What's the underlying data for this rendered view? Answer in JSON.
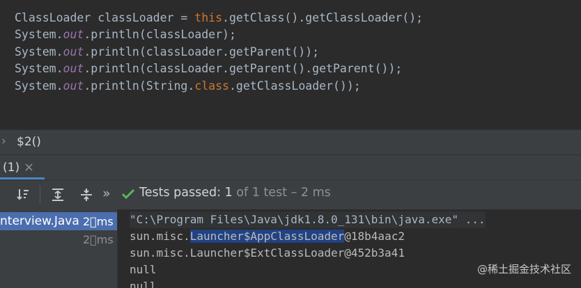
{
  "editor": {
    "line1": {
      "a": "ClassLoader classLoader = ",
      "kw": "this",
      "b": ".getClass().getClassLoader();"
    },
    "line2": {
      "a": "System.",
      "it": "out",
      "b": ".println(classLoader);"
    },
    "line3": {
      "a": "System.",
      "it": "out",
      "b": ".println(classLoader.getParent());"
    },
    "line4": {
      "a": "System.",
      "it": "out",
      "b": ".println(classLoader.getParent().getParent());"
    },
    "line5": {
      "a": "System.",
      "it": "out",
      "b": ".println(String.",
      "kw": "class",
      "c": ".getClassLoader());"
    }
  },
  "run_header": {
    "chevron": "›",
    "title": "$2()"
  },
  "tab": {
    "label": "(1)",
    "close": "×"
  },
  "toolbar": {
    "status_text": "Tests passed:",
    "count": "1",
    "count_of": "of 1 test",
    "duration": "– 2  ms",
    "more": "»"
  },
  "tree": {
    "items": [
      {
        "label": "nterview.Java",
        "time": "2\u0000ms"
      },
      {
        "label": "",
        "time": "2\u0000ms"
      }
    ]
  },
  "console": {
    "lines": [
      "\"C:\\Program Files\\Java\\jdk1.8.0_131\\bin\\java.exe\" ...",
      "sun.misc.",
      "sun.misc.Launcher$ExtClassLoader@452b3a41",
      "null",
      "null"
    ],
    "line2_highlight": "Launcher$AppClassLoader",
    "line2_rest": "@18b4aac2"
  },
  "watermark": "@稀土掘金技术社区",
  "colors": {
    "keyword": "#cc7832",
    "field": "#9876aa",
    "selection": "#4b6eaf",
    "pass": "#5fb35f"
  }
}
